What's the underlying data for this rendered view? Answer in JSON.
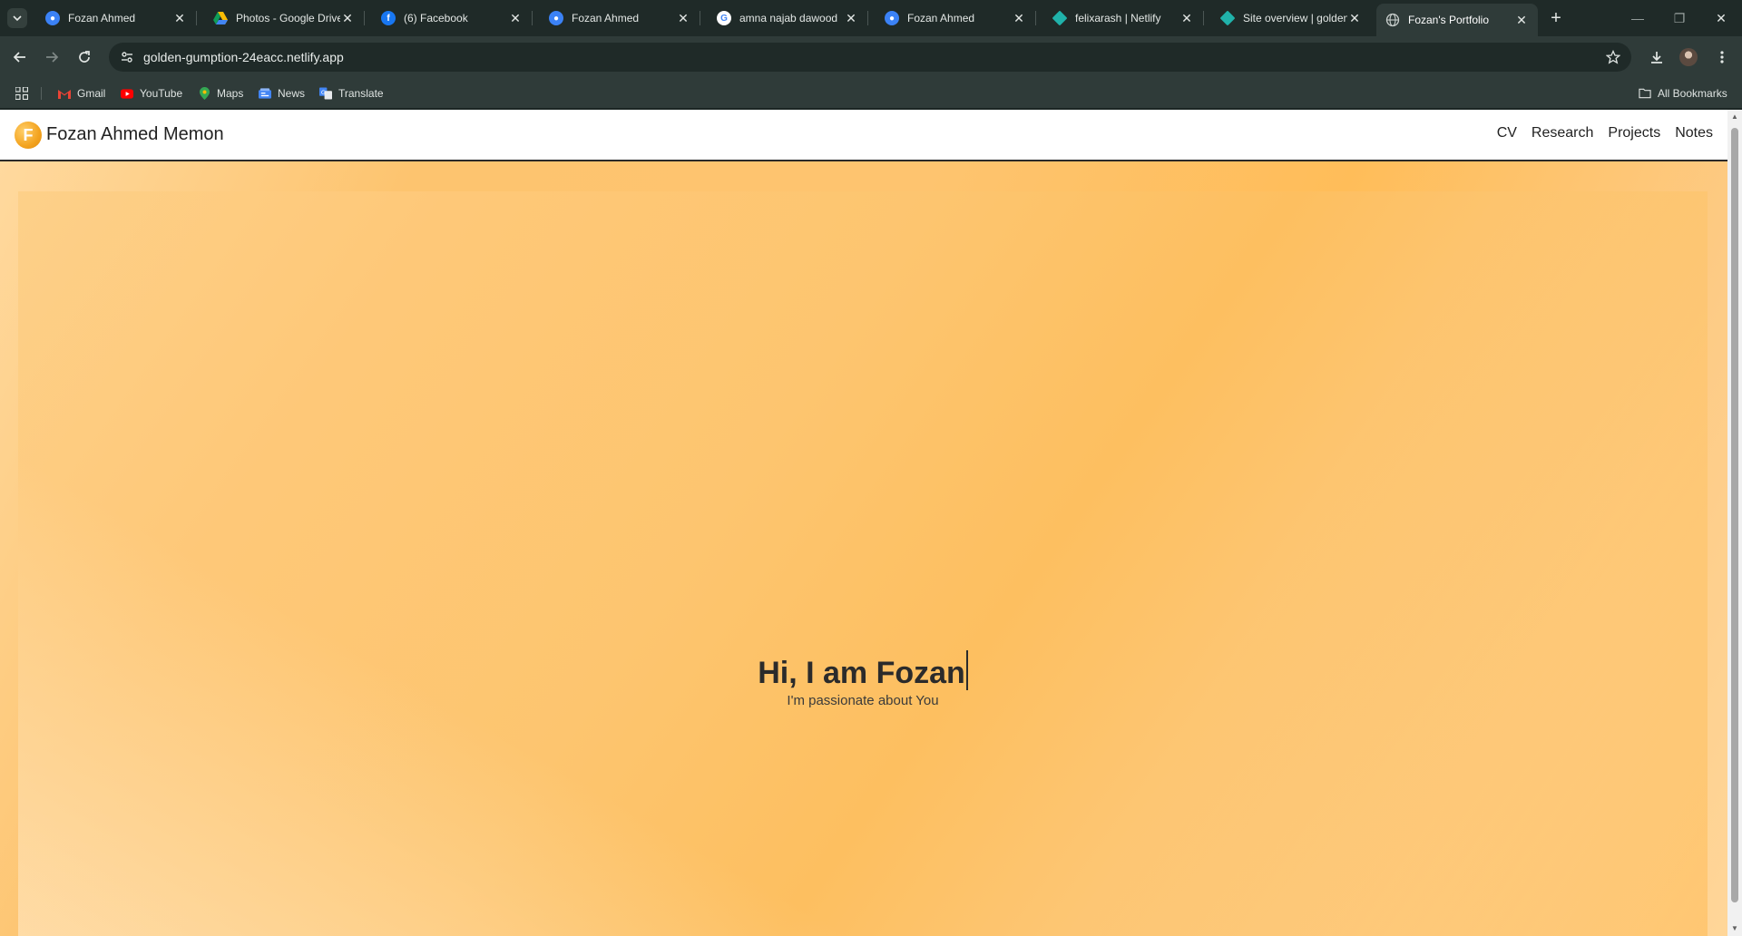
{
  "browser": {
    "tabs": [
      {
        "title": "Fozan Ahmed",
        "icon": "profile-icon",
        "active": false
      },
      {
        "title": "Photos - Google Drive",
        "icon": "google-drive-icon",
        "active": false
      },
      {
        "title": "(6) Facebook",
        "icon": "facebook-icon",
        "active": false
      },
      {
        "title": "Fozan Ahmed",
        "icon": "profile-icon",
        "active": false
      },
      {
        "title": "amna najab dawood",
        "icon": "google-icon",
        "active": false
      },
      {
        "title": "Fozan Ahmed",
        "icon": "profile-icon",
        "active": false
      },
      {
        "title": "felixarash | Netlify",
        "icon": "netlify-icon",
        "active": false
      },
      {
        "title": "Site overview | golden",
        "icon": "netlify-icon",
        "active": false
      },
      {
        "title": "Fozan's Portfolio",
        "icon": "globe-icon",
        "active": true
      }
    ],
    "url": "golden-gumption-24eacc.netlify.app",
    "bookmarks": [
      {
        "label": "Gmail",
        "icon": "gmail-icon"
      },
      {
        "label": "YouTube",
        "icon": "youtube-icon"
      },
      {
        "label": "Maps",
        "icon": "maps-icon"
      },
      {
        "label": "News",
        "icon": "news-icon"
      },
      {
        "label": "Translate",
        "icon": "translate-icon"
      }
    ],
    "all_bookmarks_label": "All Bookmarks",
    "colors": {
      "frame": "#1f2a28",
      "toolbar": "#2f3b39"
    }
  },
  "site": {
    "logo_letter": "F",
    "name": "Fozan Ahmed Memon",
    "nav": [
      "CV",
      "Research",
      "Projects",
      "Notes"
    ],
    "hero_title": "Hi, I am Fozan",
    "hero_subtitle": "I'm passionate about You",
    "colors": {
      "accent": "#fdc36f",
      "logo": "#f3a31f"
    }
  }
}
